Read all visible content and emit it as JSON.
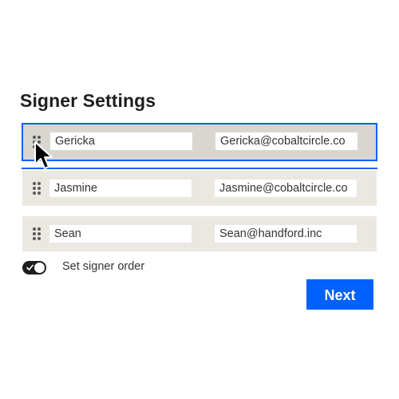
{
  "title": "Signer Settings",
  "colors": {
    "accent": "#0061fe",
    "row_background": "#ebe7e1",
    "selected_row_background": "#d9d6d0",
    "text": "#1e1e1e"
  },
  "signers": [
    {
      "name": "Gericka",
      "email": "Gericka@cobaltcircle.co",
      "state": "dragging"
    },
    {
      "name": "Jasmine",
      "email": "Jasmine@cobaltcircle.co"
    },
    {
      "name": "Sean",
      "email": "Sean@handford.inc"
    }
  ],
  "signer_order": {
    "label": "Set signer order",
    "enabled": true,
    "icon": "check-icon"
  },
  "next_button": {
    "label": "Next"
  },
  "icons": {
    "drag_handle": "drag-handle-icon",
    "cursor": "mouse-pointer-icon"
  }
}
